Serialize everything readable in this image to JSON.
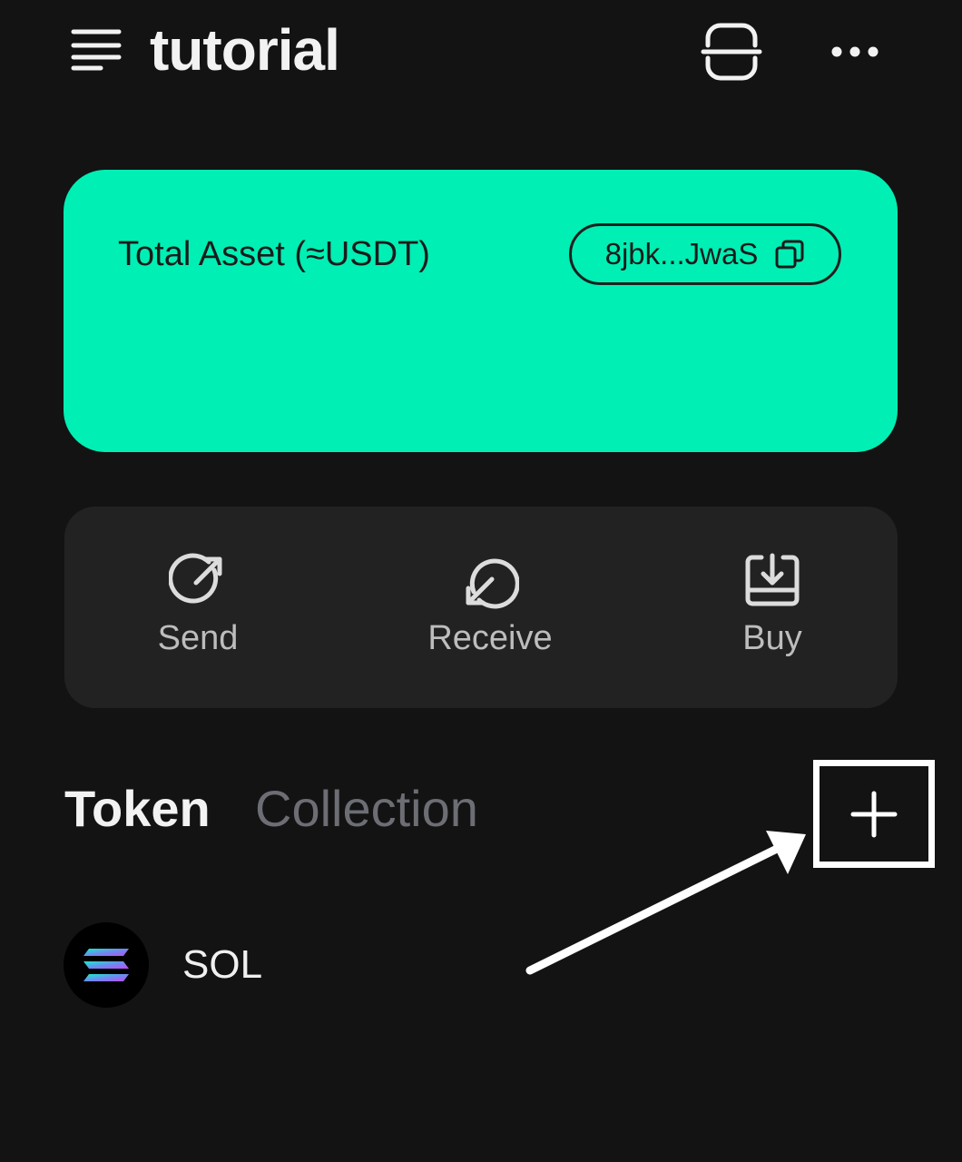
{
  "header": {
    "title": "tutorial",
    "menu_icon": "hamburger-menu-icon",
    "scan_icon": "scan-icon",
    "more_icon": "more-dots-icon"
  },
  "asset_card": {
    "label": "Total Asset (≈USDT)",
    "address": "8jbk...JwaS",
    "copy_icon": "copy-icon",
    "color": "#00efb4"
  },
  "actions": [
    {
      "label": "Send",
      "icon": "send-icon"
    },
    {
      "label": "Receive",
      "icon": "receive-icon"
    },
    {
      "label": "Buy",
      "icon": "buy-icon"
    }
  ],
  "tabs": {
    "active": "Token",
    "inactive": "Collection"
  },
  "add_token_icon": "plus-icon",
  "tokens": [
    {
      "symbol": "SOL",
      "icon": "solana-logo-icon"
    }
  ]
}
